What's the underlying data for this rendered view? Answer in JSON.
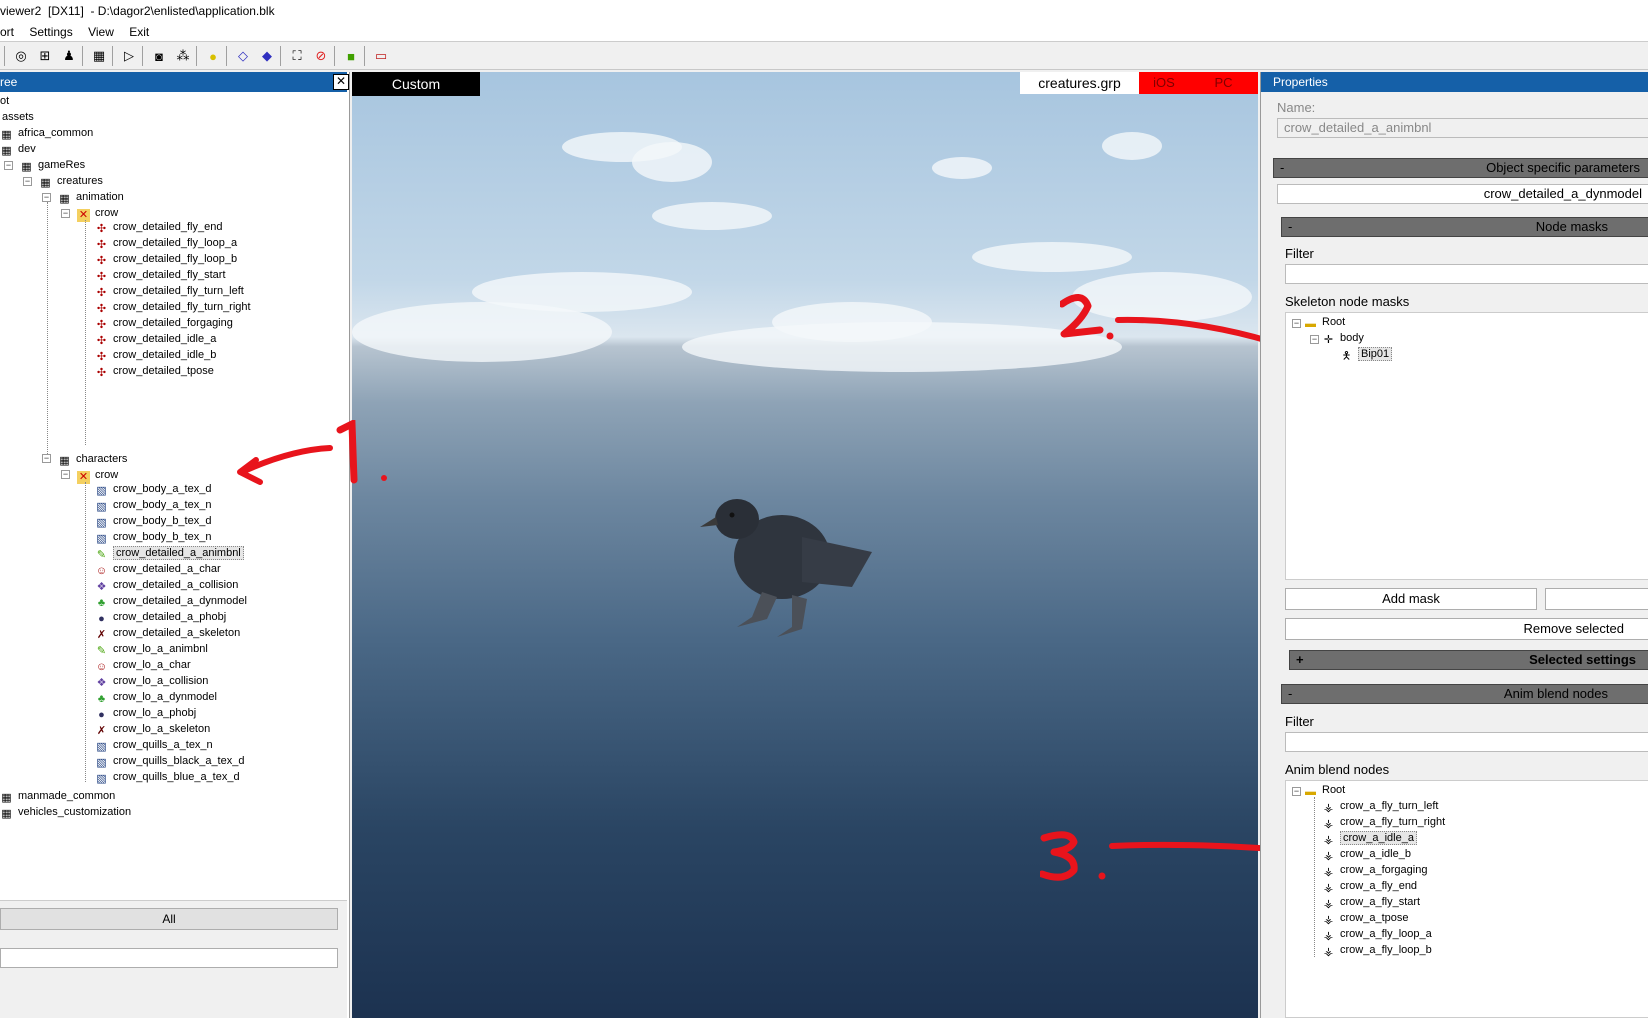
{
  "window": {
    "title": "viewer2  [DX11]  - D:\\dagor2\\enlisted\\application.blk"
  },
  "menu": [
    "ort",
    "Settings",
    "View",
    "Exit"
  ],
  "tree": {
    "header": "ree",
    "close_label": "✕",
    "root_label": "ot",
    "assets_label": "assets",
    "nodes": {
      "africa_common": "africa_common",
      "dev": "dev",
      "gameRes": "gameRes",
      "creatures": "creatures",
      "animation": "animation",
      "anim_crow": "crow",
      "characters": "characters",
      "char_crow": "crow",
      "manmade_common": "manmade_common",
      "vehicles_customization": "vehicles_customization"
    },
    "animation_items": [
      "crow_detailed_fly_end",
      "crow_detailed_fly_loop_a",
      "crow_detailed_fly_loop_b",
      "crow_detailed_fly_start",
      "crow_detailed_fly_turn_left",
      "crow_detailed_fly_turn_right",
      "crow_detailed_forgaging",
      "crow_detailed_idle_a",
      "crow_detailed_idle_b",
      "crow_detailed_tpose"
    ],
    "character_items": [
      {
        "label": "crow_body_a_tex_d",
        "icon": "texture-icon"
      },
      {
        "label": "crow_body_a_tex_n",
        "icon": "texture-icon"
      },
      {
        "label": "crow_body_b_tex_d",
        "icon": "texture-icon"
      },
      {
        "label": "crow_body_b_tex_n",
        "icon": "texture-icon"
      },
      {
        "label": "crow_detailed_a_animbnl",
        "icon": "animbnl-icon",
        "selected": true
      },
      {
        "label": "crow_detailed_a_char",
        "icon": "char-icon"
      },
      {
        "label": "crow_detailed_a_collision",
        "icon": "collision-icon"
      },
      {
        "label": "crow_detailed_a_dynmodel",
        "icon": "dynmodel-icon"
      },
      {
        "label": "crow_detailed_a_phobj",
        "icon": "phobj-icon"
      },
      {
        "label": "crow_detailed_a_skeleton",
        "icon": "skeleton-icon"
      },
      {
        "label": "crow_lo_a_animbnl",
        "icon": "animbnl-icon"
      },
      {
        "label": "crow_lo_a_char",
        "icon": "char-icon"
      },
      {
        "label": "crow_lo_a_collision",
        "icon": "collision-icon"
      },
      {
        "label": "crow_lo_a_dynmodel",
        "icon": "dynmodel-icon"
      },
      {
        "label": "crow_lo_a_phobj",
        "icon": "phobj-icon"
      },
      {
        "label": "crow_lo_a_skeleton",
        "icon": "skeleton-icon"
      },
      {
        "label": "crow_quills_a_tex_n",
        "icon": "texture-icon"
      },
      {
        "label": "crow_quills_black_a_tex_d",
        "icon": "texture-icon"
      },
      {
        "label": "crow_quills_blue_a_tex_d",
        "icon": "texture-icon"
      }
    ],
    "filter_all_label": "All"
  },
  "viewport": {
    "camera_label": "Custom",
    "group_label": "creatures.grp",
    "ios_label": "iOS",
    "pc_label": "PC"
  },
  "properties": {
    "header": "Properties",
    "name_label": "Name:",
    "name_value": "crow_detailed_a_animbnl",
    "object_section": {
      "toggle": "-",
      "title": "Object specific parameters"
    },
    "dynmodel_value": "crow_detailed_a_dynmodel",
    "node_masks": {
      "toggle": "-",
      "title": "Node masks"
    },
    "filter_label": "Filter",
    "skeleton_label": "Skeleton node masks",
    "skeleton_tree": {
      "root": "Root",
      "body": "body",
      "bip": "Bip01"
    },
    "add_mask_label": "Add mask",
    "remove_selected_label": "Remove selected",
    "selected_settings": {
      "toggle": "+",
      "title": "Selected settings"
    },
    "anim_blend": {
      "toggle": "-",
      "title": "Anim blend nodes"
    },
    "filter2_label": "Filter",
    "anim_blend_label": "Anim blend nodes",
    "blend_root": "Root",
    "blend_items": [
      "crow_a_fly_turn_left",
      "crow_a_fly_turn_right",
      "crow_a_idle_a",
      "crow_a_idle_b",
      "crow_a_forgaging",
      "crow_a_fly_end",
      "crow_a_fly_start",
      "crow_a_tpose",
      "crow_a_fly_loop_a",
      "crow_a_fly_loop_b"
    ],
    "blend_selected_index": 2
  },
  "annotations": [
    "1.",
    "2.",
    "3."
  ],
  "colors": {
    "accent": "#1560a8",
    "annotation": "#e8141c",
    "platform_red": "#ff0000"
  }
}
